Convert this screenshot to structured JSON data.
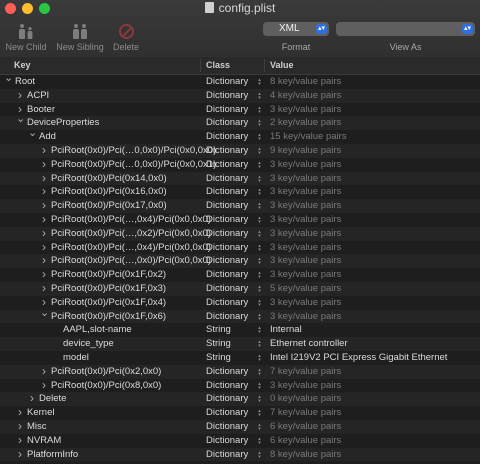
{
  "window": {
    "title": "config.plist"
  },
  "toolbar": {
    "new_child": "New Child",
    "new_sibling": "New Sibling",
    "delete": "Delete",
    "format_value": "XML",
    "format_label": "Format",
    "view_as_value": "",
    "view_as_label": "View As"
  },
  "header": {
    "key": "Key",
    "class": "Class",
    "value": "Value"
  },
  "rows": [
    {
      "key": "Root",
      "class": "Dictionary",
      "value": "8 key/value pairs",
      "depth": 0,
      "expanded": true,
      "dim": true
    },
    {
      "key": "ACPI",
      "class": "Dictionary",
      "value": "4 key/value pairs",
      "depth": 1,
      "expanded": false,
      "dim": true
    },
    {
      "key": "Booter",
      "class": "Dictionary",
      "value": "3 key/value pairs",
      "depth": 1,
      "expanded": false,
      "dim": true
    },
    {
      "key": "DeviceProperties",
      "class": "Dictionary",
      "value": "2 key/value pairs",
      "depth": 1,
      "expanded": true,
      "dim": true
    },
    {
      "key": "Add",
      "class": "Dictionary",
      "value": "15 key/value pairs",
      "depth": 2,
      "expanded": true,
      "dim": true
    },
    {
      "key": "PciRoot(0x0)/Pci(…0,0x0)/Pci(0x0,0x0)",
      "class": "Dictionary",
      "value": "9 key/value pairs",
      "depth": 3,
      "expanded": false,
      "dim": true
    },
    {
      "key": "PciRoot(0x0)/Pci(…0,0x0)/Pci(0x0,0x1)",
      "class": "Dictionary",
      "value": "3 key/value pairs",
      "depth": 3,
      "expanded": false,
      "dim": true
    },
    {
      "key": "PciRoot(0x0)/Pci(0x14,0x0)",
      "class": "Dictionary",
      "value": "3 key/value pairs",
      "depth": 3,
      "expanded": false,
      "dim": true
    },
    {
      "key": "PciRoot(0x0)/Pci(0x16,0x0)",
      "class": "Dictionary",
      "value": "3 key/value pairs",
      "depth": 3,
      "expanded": false,
      "dim": true
    },
    {
      "key": "PciRoot(0x0)/Pci(0x17,0x0)",
      "class": "Dictionary",
      "value": "3 key/value pairs",
      "depth": 3,
      "expanded": false,
      "dim": true
    },
    {
      "key": "PciRoot(0x0)/Pci(…,0x4)/Pci(0x0,0x0)",
      "class": "Dictionary",
      "value": "3 key/value pairs",
      "depth": 3,
      "expanded": false,
      "dim": true
    },
    {
      "key": "PciRoot(0x0)/Pci(…,0x2)/Pci(0x0,0x0)",
      "class": "Dictionary",
      "value": "3 key/value pairs",
      "depth": 3,
      "expanded": false,
      "dim": true
    },
    {
      "key": "PciRoot(0x0)/Pci(…,0x4)/Pci(0x0,0x0)",
      "class": "Dictionary",
      "value": "3 key/value pairs",
      "depth": 3,
      "expanded": false,
      "dim": true
    },
    {
      "key": "PciRoot(0x0)/Pci(…,0x0)/Pci(0x0,0x0)",
      "class": "Dictionary",
      "value": "3 key/value pairs",
      "depth": 3,
      "expanded": false,
      "dim": true
    },
    {
      "key": "PciRoot(0x0)/Pci(0x1F,0x2)",
      "class": "Dictionary",
      "value": "3 key/value pairs",
      "depth": 3,
      "expanded": false,
      "dim": true
    },
    {
      "key": "PciRoot(0x0)/Pci(0x1F,0x3)",
      "class": "Dictionary",
      "value": "5 key/value pairs",
      "depth": 3,
      "expanded": false,
      "dim": true
    },
    {
      "key": "PciRoot(0x0)/Pci(0x1F,0x4)",
      "class": "Dictionary",
      "value": "3 key/value pairs",
      "depth": 3,
      "expanded": false,
      "dim": true
    },
    {
      "key": "PciRoot(0x0)/Pci(0x1F,0x6)",
      "class": "Dictionary",
      "value": "3 key/value pairs",
      "depth": 3,
      "expanded": true,
      "dim": true
    },
    {
      "key": "AAPL,slot-name",
      "class": "String",
      "value": "Internal",
      "depth": 4,
      "leaf": true,
      "dim": false
    },
    {
      "key": "device_type",
      "class": "String",
      "value": "Ethernet controller",
      "depth": 4,
      "leaf": true,
      "dim": false
    },
    {
      "key": "model",
      "class": "String",
      "value": "Intel I219V2 PCI Express Gigabit Ethernet",
      "depth": 4,
      "leaf": true,
      "dim": false
    },
    {
      "key": "PciRoot(0x0)/Pci(0x2,0x0)",
      "class": "Dictionary",
      "value": "7 key/value pairs",
      "depth": 3,
      "expanded": false,
      "dim": true
    },
    {
      "key": "PciRoot(0x0)/Pci(0x8,0x0)",
      "class": "Dictionary",
      "value": "3 key/value pairs",
      "depth": 3,
      "expanded": false,
      "dim": true
    },
    {
      "key": "Delete",
      "class": "Dictionary",
      "value": "0 key/value pairs",
      "depth": 2,
      "expanded": false,
      "dim": true
    },
    {
      "key": "Kernel",
      "class": "Dictionary",
      "value": "7 key/value pairs",
      "depth": 1,
      "expanded": false,
      "dim": true
    },
    {
      "key": "Misc",
      "class": "Dictionary",
      "value": "6 key/value pairs",
      "depth": 1,
      "expanded": false,
      "dim": true
    },
    {
      "key": "NVRAM",
      "class": "Dictionary",
      "value": "6 key/value pairs",
      "depth": 1,
      "expanded": false,
      "dim": true
    },
    {
      "key": "PlatformInfo",
      "class": "Dictionary",
      "value": "8 key/value pairs",
      "depth": 1,
      "expanded": false,
      "dim": true
    }
  ]
}
